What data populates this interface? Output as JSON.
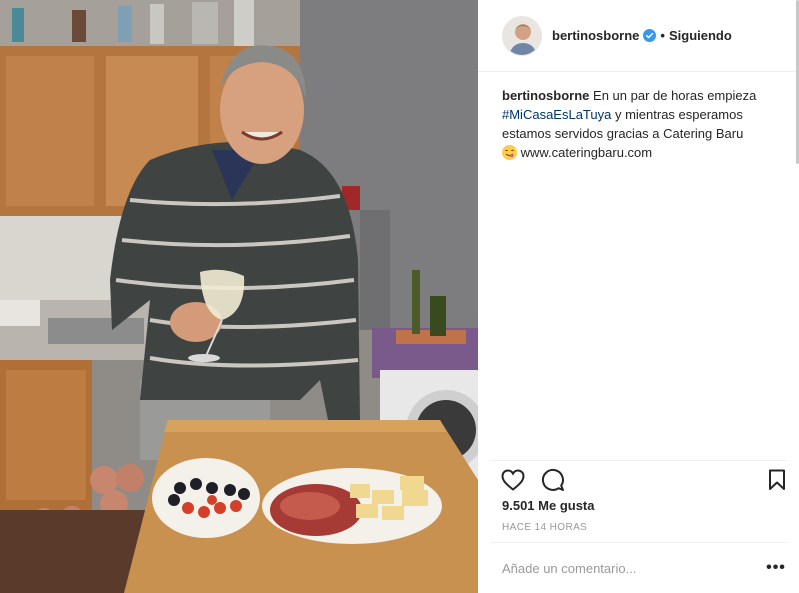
{
  "post": {
    "username": "bertinosborne",
    "follow_label": "Siguiendo",
    "separator": "•",
    "caption": {
      "username": "bertinosborne",
      "text_before_tag": " En un par de horas empieza ",
      "hashtag": "#MiCasaEsLaTuya",
      "text_after_tag": " y mientras esperamos estamos servidos gracias a Catering Baru ",
      "link_text": " www.cateringbaru.com"
    },
    "likes": "9.501 Me gusta",
    "timestamp": "HACE 14 HORAS",
    "comment_placeholder": "Añade un comentario...",
    "more_label": "•••"
  },
  "icons": {
    "verified": "verified-badge-icon",
    "like": "heart-icon",
    "comment": "comment-bubble-icon",
    "save": "bookmark-icon",
    "emoji": "yum-face-emoji"
  },
  "colors": {
    "verified": "#3897f0",
    "hashtag": "#003569",
    "muted": "#999999",
    "border": "#efefef"
  }
}
